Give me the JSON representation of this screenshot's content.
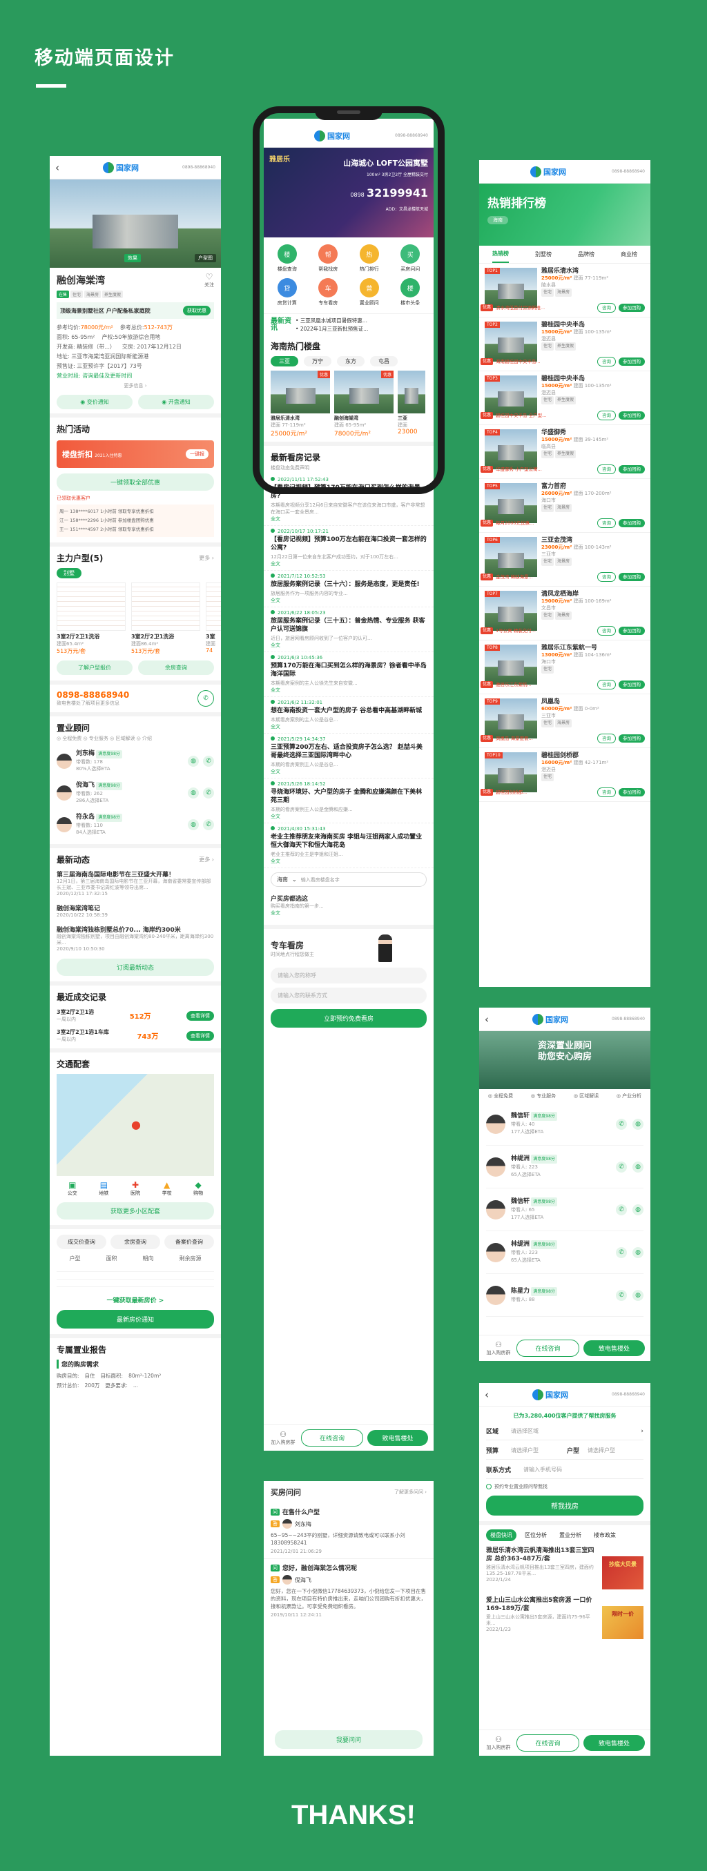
{
  "page": {
    "heading": "移动端页面设计",
    "thanks": "THANKS!"
  },
  "common": {
    "logo": "国家网",
    "hotline": "0898-88868940",
    "back": "‹"
  },
  "detail": {
    "project_name": "融创海棠湾",
    "follow": "关注",
    "img_tags": [
      "效果",
      "户型图"
    ],
    "tags": [
      "在售",
      "住宅",
      "海景房",
      "养生度假"
    ],
    "slogan": "顶级海景别墅社区 户户配备私家庭院",
    "slogan_btn": "获取优惠",
    "ref_price_label": "参考均价:",
    "ref_price": "78000元/m²",
    "ref_total_label": "参考总价:",
    "ref_total": "512-743万",
    "area": "面积: 65-95m²",
    "property": "产权:50年旅游综合用地",
    "developer": "开发商: 精装修（带...）",
    "delivery": "交房: 2017年12月12日",
    "address": "地址: 三亚市海棠湾亚润国际新能源港",
    "permit": "预售证: 三亚预许字【2017】73号",
    "nearby": "营业时段: 咨询最佳及更新时间",
    "more_info": "更多信息 ›",
    "btn_price": "变价通知",
    "btn_open": "开盘通知",
    "activity_title": "热门活动",
    "activity_banner": "楼盘折扣",
    "activity_sub": "2021入住特惠",
    "activity_btn": "一键报",
    "activity_cta": "一键领取全部优惠",
    "activity_note": "已领取优惠客户",
    "activity_list": [
      "周一 138****6017 1小时前  领取专享优惠折扣",
      "江一 158****2296 1小时前  参加楼盘团购优惠",
      "王一 151****4597 2小时前  领取专享优惠折扣"
    ],
    "layout_title": "主力户型(5)",
    "layout_more": "更多 ›",
    "layout_filter": "别墅",
    "layouts": [
      {
        "name": "3室2厅2卫1洗浴",
        "area": "建面65.4m²",
        "price": "513万元/套"
      },
      {
        "name": "3室2厅2卫1洗浴",
        "area": "建面86.4m²",
        "price": "513万元/套"
      },
      {
        "name": "3室",
        "area": "建面",
        "price": "74"
      }
    ],
    "btn_layout_price": "了解户型报价",
    "btn_remain": "余房查询",
    "phone": "0898-88868940",
    "phone_sub": "致电售楼处了解项目更多信息",
    "advisor_title": "置业顾问",
    "advisor_sub": "◎ 全程免费  ◎ 专业服务  ◎ 区域解读  ◎ 介绍",
    "advisors": [
      {
        "name": "刘东梅",
        "badge": "满意度98分",
        "count": "带看数: 178",
        "rate": "80%人选择ETA"
      },
      {
        "name": "倪海飞",
        "badge": "满意度98分",
        "count": "带看数: 262",
        "rate": "286人选择ETA"
      },
      {
        "name": "符永岛",
        "badge": "满意度98分",
        "count": "带看数: 110",
        "rate": "84人选择ETA"
      }
    ],
    "news_title": "最新动态",
    "news_more": "更多 ›",
    "news": [
      {
        "title": "第三届海南岛国际电影节在三亚盛大开幕！",
        "body": "12月1日，第三届海南岛国际电影节在三亚开幕，海南省委常委宣传部部长王斌、三亚市委书记周红波等领导出席...",
        "date": "2020/12/11 17:32:15"
      },
      {
        "title": "融创海棠湾笔记",
        "body": "",
        "date": "2020/10/22 10:58:39"
      },
      {
        "title": "融创海棠湾独栋别墅总价70... 海岸约300米",
        "body": "融创海棠湾独栋别墅，项目由融创海棠湾约80-240平米，距离海岸约300米...",
        "date": "2020/9/10 10:50:30"
      }
    ],
    "news_btn": "订阅最新动态",
    "deals_title": "最近成交记录",
    "deals": [
      {
        "layout": "3室2厅2卫1浴",
        "when": "一周以内",
        "price": "512万",
        "btn": "查看详情"
      },
      {
        "layout": "3室2厅2卫1浴1车库",
        "when": "一周以内",
        "price": "743万",
        "btn": "查看详情"
      }
    ],
    "traffic_title": "交通配套",
    "traffic_icons": [
      "公交",
      "地铁",
      "医院",
      "学校",
      "购物"
    ],
    "traffic_btn": "获取更多小区配套",
    "query_tabs": [
      "成交价查询",
      "余房查询",
      "备案价查询"
    ],
    "query_heads": [
      "户型",
      "面积",
      "朝向",
      "剩余房源"
    ],
    "query_link": "一键获取最新房价 >",
    "query_btn": "最新房价通知",
    "report_title": "专属置业报告",
    "report_sub": "您的购房需求",
    "report_rows": [
      {
        "k": "购房目的:",
        "v": "自住",
        "k2": "目标面积:",
        "v2": "80m²-120m²"
      },
      {
        "k": "预计总价:",
        "v": "200万",
        "k2": "更多要求:",
        "v2": "..."
      }
    ]
  },
  "home": {
    "banner_brand": "雅居乐",
    "banner_title": "山海城心 LOFT公园寓墅",
    "banner_sub": "100m² 3房2卫2厅 全屋精装交付",
    "banner_phone_label": "0898",
    "banner_phone": "32199941",
    "banner_addr": "ADD：文昌龙楼航天城",
    "nav": [
      {
        "icon": "楼",
        "label": "楼盘查询"
      },
      {
        "icon": "帮",
        "label": "帮我找房"
      },
      {
        "icon": "热",
        "label": "热门排行"
      },
      {
        "icon": "买",
        "label": "买房问问"
      },
      {
        "icon": "贷",
        "label": "房贷计算"
      },
      {
        "icon": "车",
        "label": "专车看房"
      },
      {
        "icon": "营",
        "label": "置业顾问"
      },
      {
        "icon": "楼",
        "label": "楼市头条"
      }
    ],
    "headline_label": "最新资讯",
    "headlines": [
      "三亚凤凰水城项目暑假特惠...",
      "2022年1月三亚新批预售证..."
    ],
    "hot_title": "海南热门楼盘",
    "hot_tabs": [
      "三亚",
      "万宁",
      "东方",
      "屯昌"
    ],
    "hot_cards": [
      {
        "name": "雅居乐清水湾",
        "area": "建面 77-119m²",
        "price": "25000元/m²",
        "badge": "优惠"
      },
      {
        "name": "融创海棠湾",
        "area": "建面 65-95m²",
        "price": "78000元/m²",
        "badge": "优惠"
      },
      {
        "name": "三亚",
        "area": "建面",
        "price": "23000"
      }
    ],
    "record_title": "最新看房记录",
    "record_sub": "楼盘动态免费声明",
    "records": [
      {
        "date": "2022/11/11 17:52:43",
        "title": "【看房记视频】预算170万能在海口买到怎么样的海景房?",
        "body": "本期看房视频分享12月6日来自安徽客户在该位来海口市盛，客户非常想在海口买一套全景房..."
      },
      {
        "date": "2022/10/17 10:17:21",
        "title": "【看房记视频】预算100万左右能在海口投资一套怎样的公寓?",
        "body": "12月22日第一位来自东北客户成功签约，对于100万左右..."
      },
      {
        "date": "2021/7/12 10:52:53",
        "title": "旅居服务案例记录（三十六）：服务是态度，更是责任!",
        "body": "旅居服务作为一项服务内容的专业..."
      },
      {
        "date": "2021/6/22 18:05:23",
        "title": "旅居服务案例记录（三十五）：普金热情、专业服务 获客户认可送锦旗",
        "body": "近日，旅居网看房顾问收到了一位客户的认可..."
      },
      {
        "date": "2021/6/3 10:45:36",
        "title": "预算170万能在海口买到怎么样的海景房？徐者看中半岛海洋国际",
        "body": "本期看房案例的主人公徐先生来自安徽..."
      },
      {
        "date": "2021/6/2 11:32:01",
        "title": "想在海南投资一套大户型的房子 谷总看中高基湖畔新城",
        "body": "本期看房案例的主人公是谷总..."
      },
      {
        "date": "2021/5/29 14:34:37",
        "title": "三亚预算200万左右、适合投资房子怎么选？ 赵喆斗美哥最终选择三亚国际湾畔中心",
        "body": "本期的看房案例主人公是谷总..."
      },
      {
        "date": "2021/5/26 18:14:52",
        "title": "寻烧海环境好、大户型的房子 金腾和应嫌满颜在下美林苑三期",
        "body": "本期的看房案例主人公是金腾和应嫌..."
      },
      {
        "date": "2021/4/30 15:31:43",
        "title": "老业主推荐朋友来海南买房 李姐与汪姐两家人成功置业恒大御海天下和恒大海花岛",
        "body": "老业主推荐的业主是李姐和汪姐..."
      }
    ],
    "record_more": "全文",
    "form_region": "海南",
    "form_region_ph": "输入看房楼盘名字",
    "recommend_title": "户买房都选这",
    "recommend_body": "购买看房指南的第一步...",
    "car_title": "专车看房",
    "car_sub": "时间地点行程您做主",
    "car_ph1": "请输入您的称呼",
    "car_ph2": "请输入您的联系方式",
    "car_btn": "立即预约免费看房",
    "bottom_left": "加入购房群",
    "bottom_consult": "在线咨询",
    "bottom_call": "致电售楼处"
  },
  "rank": {
    "title": "热销排行榜",
    "badge": "海南",
    "tabs": [
      "热销榜",
      "别墅榜",
      "品牌榜",
      "商业榜"
    ],
    "items": [
      {
        "no": "TOP1",
        "name": "雅居乐清水湾",
        "price": "25000元/m²",
        "area": "建面 77-119m²",
        "loc": "陵水县",
        "tags": [
          "住宅",
          "海景房"
        ],
        "promo": "清水湾低首付房源新推..."
      },
      {
        "no": "TOP2",
        "name": "碧桂园中央半岛",
        "price": "15000元/m²",
        "area": "建面 100-135m²",
        "loc": "澄迈县",
        "tags": [
          "住宅",
          "养生度假"
        ],
        "promo": "海南碧桂园中央半岛..."
      },
      {
        "no": "TOP3",
        "name": "碧桂园中央半岛",
        "price": "15000元/m²",
        "area": "建面 100-135m²",
        "loc": "澄迈县",
        "tags": [
          "住宅",
          "养生度假"
        ],
        "promo": "碧桂园中央半岛 全户型..."
      },
      {
        "no": "TOP4",
        "name": "华盛御秀",
        "price": "15000元/m²",
        "area": "建面 39-145m²",
        "loc": "临高县",
        "tags": [
          "住宅",
          "养生度假"
        ],
        "promo": "华盛御秀 小户型公寓..."
      },
      {
        "no": "TOP5",
        "name": "富力首府",
        "price": "26000元/m²",
        "area": "建面 170-200m²",
        "loc": "海口市",
        "tags": [
          "住宅",
          "海景房"
        ],
        "promo": "每月2000元优惠..."
      },
      {
        "no": "TOP6",
        "name": "三亚金茂湾",
        "price": "23000元/m²",
        "area": "建面 100-143m²",
        "loc": "三亚市",
        "tags": [
          "住宅",
          "海景房"
        ],
        "promo": "金茂湾 稀缺海景..."
      },
      {
        "no": "TOP7",
        "name": "清凤龙栖海岸",
        "price": "19000元/m²",
        "area": "建面 100-169m²",
        "loc": "文昌市",
        "tags": [
          "住宅",
          "海景房"
        ],
        "promo": "1号公寓 精装交付..."
      },
      {
        "no": "TOP8",
        "name": "雅居乐江东紫航一号",
        "price": "13000元/m²",
        "area": "建面 104-136m²",
        "loc": "海口市",
        "tags": [
          "住宅"
        ],
        "promo": "雅居乐江东紫航..."
      },
      {
        "no": "TOP9",
        "name": "凤凰岛",
        "price": "60000元/m²",
        "area": "建面 0-0m²",
        "loc": "三亚市",
        "tags": [
          "住宅",
          "海景房"
        ],
        "promo": "凤凰岛 海景度假..."
      },
      {
        "no": "TOP10",
        "name": "碧桂园剑桥郡",
        "price": "16000元/m²",
        "area": "建面 42-171m²",
        "loc": "澄迈县",
        "tags": [
          "住宅"
        ],
        "promo": "碧桂园剑桥郡..."
      }
    ],
    "btn_consult": "咨询",
    "btn_group": "参加团购"
  },
  "advisor": {
    "banner": "资深置业顾问\n助您安心购房",
    "features": [
      "◎ 全程免费",
      "◎ 专业服务",
      "◎ 区域解读",
      "◎ 产业分析"
    ],
    "list": [
      {
        "name": "魏信轩",
        "badge": "满意度98分",
        "count": "带看人: 40",
        "rate": "177人选择ETA"
      },
      {
        "name": "林缇洲",
        "badge": "满意度98分",
        "count": "带看人: 223",
        "rate": "65人选择ETA"
      },
      {
        "name": "魏信轩",
        "badge": "满意度98分",
        "count": "带看人: 65",
        "rate": "177人选择ETA"
      },
      {
        "name": "林缇洲",
        "badge": "满意度98分",
        "count": "带看人: 223",
        "rate": "65人选择ETA"
      },
      {
        "name": "陈星力",
        "badge": "满意度98分",
        "count": "带看人: 88",
        "rate": ""
      }
    ]
  },
  "find": {
    "stats": "已为3,280,400位客户提供了帮找房服务",
    "stats_num": "3,280,400",
    "region_label": "区域",
    "region_ph": "请选择区域",
    "budget_label": "预算",
    "budget_ph": "请选择户型",
    "type_label": "户型",
    "type_ph": "请选择户型",
    "contact_label": "联系方式",
    "contact_ph": "请输入手机号码",
    "agree": "预约专业置业顾问帮我找",
    "btn": "帮我找房",
    "tabs": [
      "楼盘快讯",
      "区位分析",
      "置业分析",
      "楼市政策"
    ],
    "news": [
      {
        "title": "雅居乐清水湾云帆清海推出13套三室四房 总价363-487万/套",
        "body": "雅居乐清水湾云帆项目推出13套三室四房，建面约135.25-187.78平米...",
        "date": "2022/1/24"
      },
      {
        "title": "爱上山三山水公寓推出5套房源 一口价169-189万/套",
        "body": "爱上山三山水公寓推出5套房源，建面约75-96平米...",
        "date": "2022/1/23"
      }
    ],
    "ad1": "抄底大贝景",
    "ad2": "限时一价",
    "bottom_left": "加入购房群",
    "bottom_consult": "在线咨询",
    "bottom_call": "致电售楼处"
  },
  "qa": {
    "title": "买房问问",
    "more": "了解更多问问 ›",
    "items": [
      {
        "q": "在售什么户型",
        "user": "刘东梅",
        "a": "65~95~~243平的别墅，详细资源请致电或可以联系小刘18308958241",
        "date": "2021/12/01 21:06:29"
      },
      {
        "q": "您好，融创海棠怎么情况呢",
        "user": "倪海飞",
        "a": "您好，您在一下小倪微信17784639373，小倪给您发一下项目在售的资料，现在项目有特价房推出来，走咱们公司团购有折扣优惠大，接和机票款让。可享受免费组织看房。",
        "date": "2019/10/11 12:24:11"
      }
    ],
    "btn": "我要问问"
  }
}
